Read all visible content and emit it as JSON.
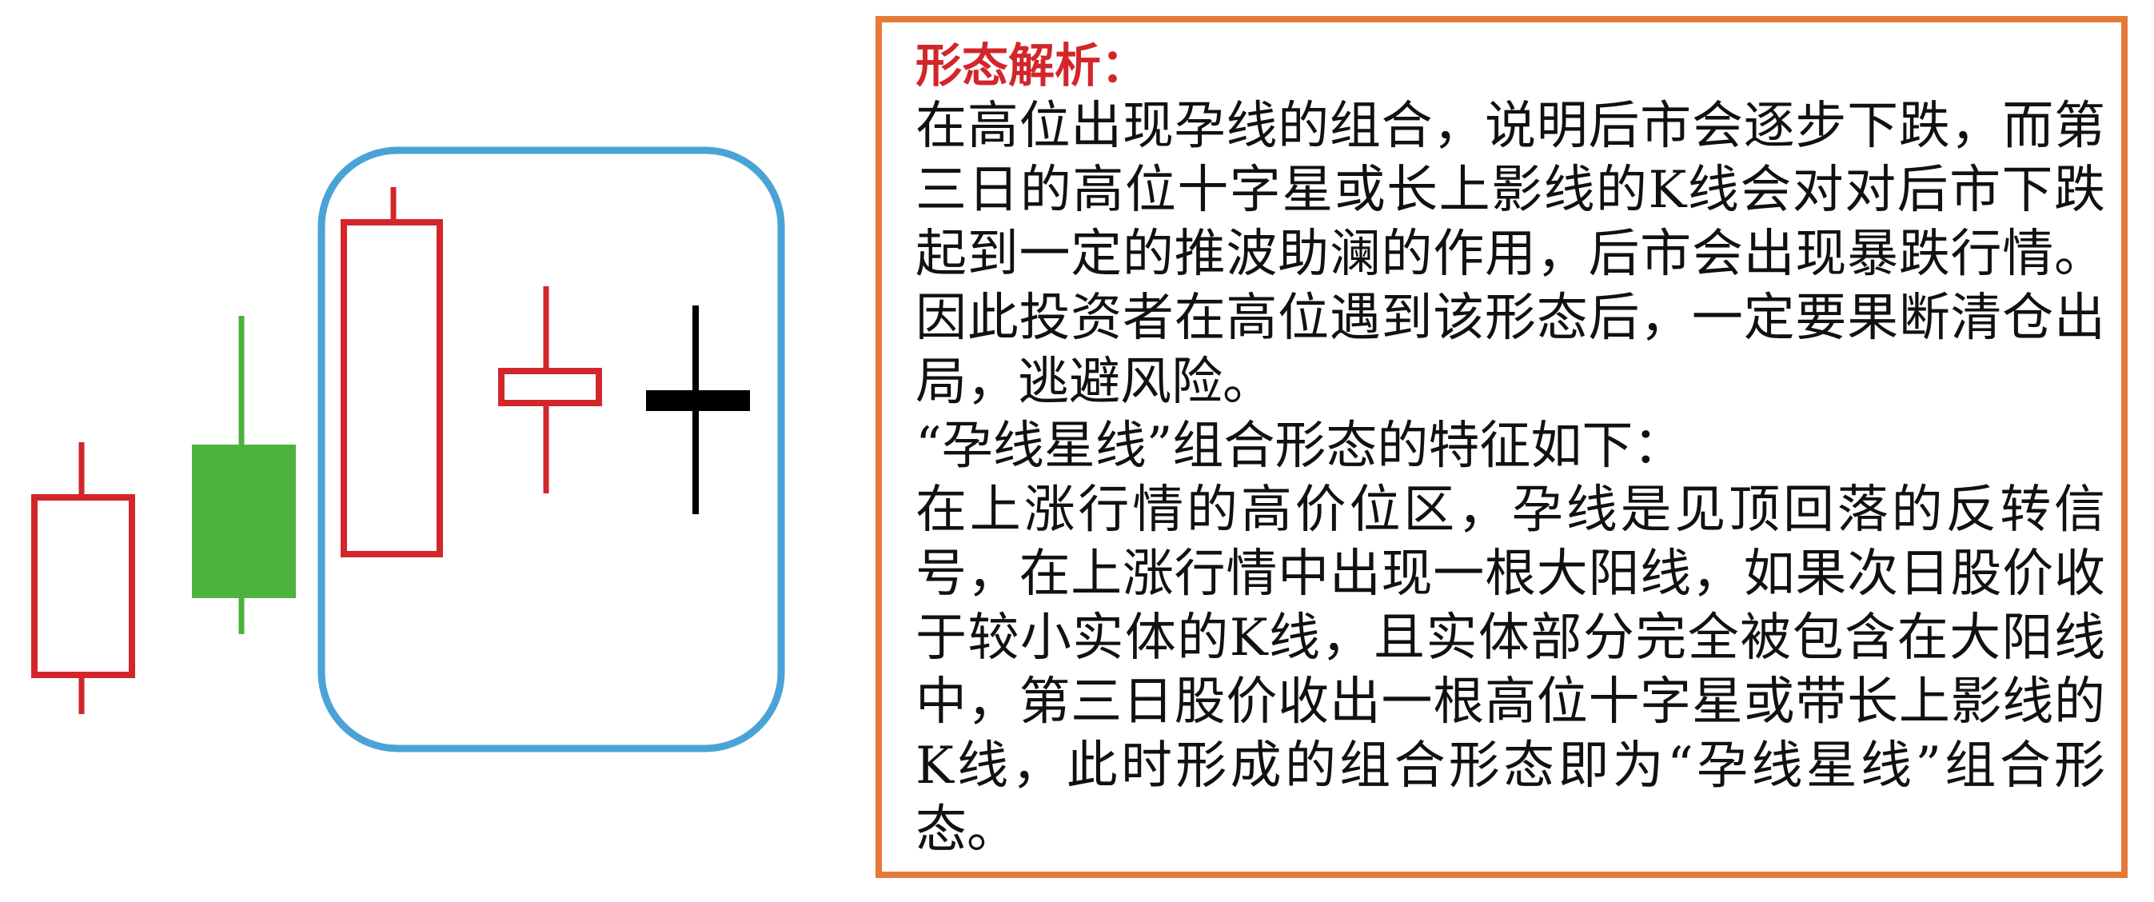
{
  "colors": {
    "yang": "#d2262a",
    "yin": "#4cb33c",
    "star": "#000000",
    "highlight_frame": "#4aa3d6",
    "panel_border": "#e57939",
    "title": "#d2262a",
    "text": "#111111"
  },
  "candles": [
    {
      "id": "candle-1",
      "kind": "yang-hollow"
    },
    {
      "id": "candle-2",
      "kind": "yin-filled"
    },
    {
      "id": "candle-3",
      "kind": "big-yang-hollow"
    },
    {
      "id": "candle-4",
      "kind": "small-yang-hollow"
    },
    {
      "id": "candle-5",
      "kind": "doji-star"
    }
  ],
  "panel": {
    "title": "形态解析：",
    "paragraph1": "在高位出现孕线的组合，说明后市会逐步下跌，而第三日的高位十字星或长上影线的K线会对对后市下跌起到一定的推波助澜的作用，后市会出现暴跌行情。因此投资者在高位遇到该形态后，一定要果断清仓出局，逃避风险。",
    "paragraph2": "“孕线星线”组合形态的特征如下：",
    "paragraph3": "在上涨行情的高价位区，孕线是见顶回落的反转信号，在上涨行情中出现一根大阳线，如果次日股价收于较小实体的K线，且实体部分完全被包含在大阳线中，第三日股价收出一根高位十字星或带长上影线的K线，此时形成的组合形态即为“孕线星线”组合形态。"
  }
}
